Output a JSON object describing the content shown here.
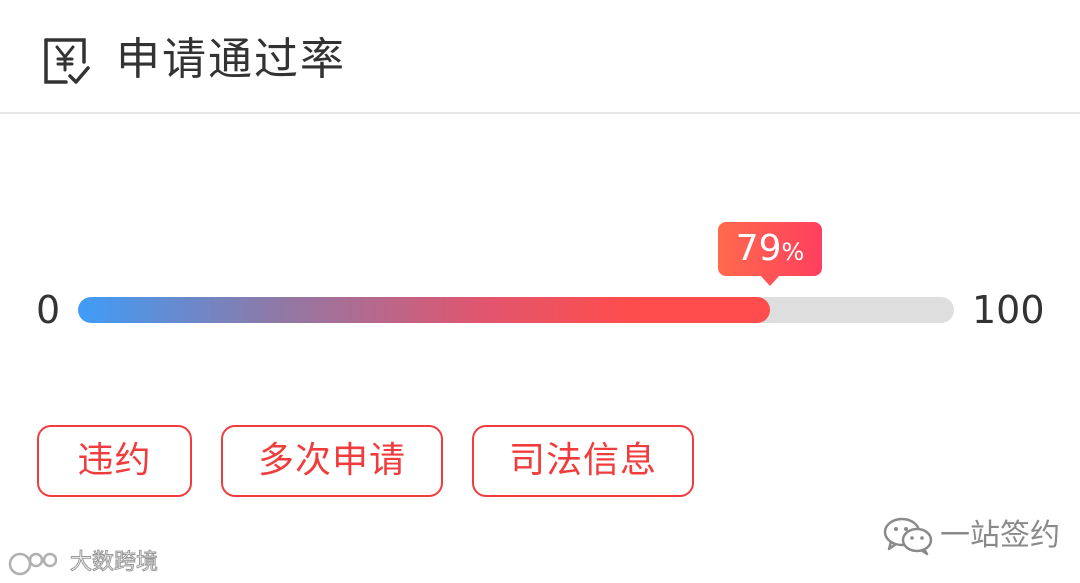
{
  "header": {
    "icon": "receipt-yuan-icon",
    "title": "申请通过率"
  },
  "gauge": {
    "min_label": "0",
    "max_label": "100",
    "value": 79,
    "value_label": "79",
    "unit": "%",
    "min": 0,
    "max": 100,
    "colors": {
      "start": "#3f9cf8",
      "end": "#ff4d4d",
      "track": "#dedede"
    }
  },
  "tags": [
    {
      "label": "违约"
    },
    {
      "label": "多次申请"
    },
    {
      "label": "司法信息"
    }
  ],
  "tag_color": "#f03c3c",
  "watermarks": {
    "left_text": "大数跨境",
    "right_text": "一站签约",
    "right_icon": "wechat-icon"
  }
}
